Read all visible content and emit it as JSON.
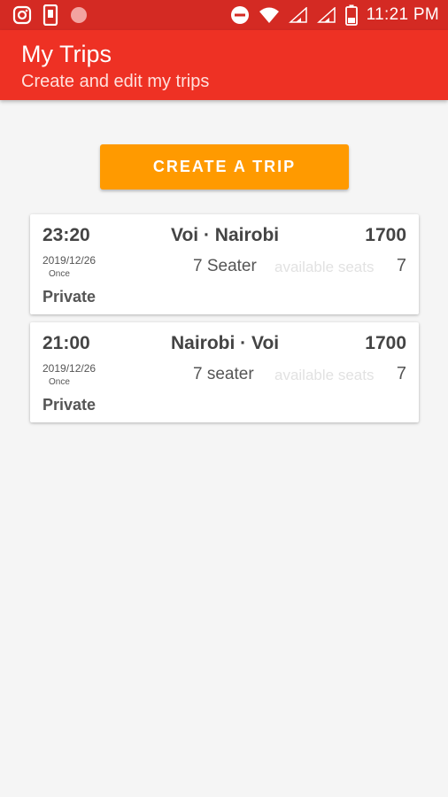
{
  "status_bar": {
    "time": "11:21 PM",
    "icons": [
      "instagram-icon",
      "phone-notification-icon",
      "circle-notification-icon",
      "do-not-disturb-icon",
      "wifi-icon",
      "signal-icon",
      "signal-icon",
      "battery-icon"
    ]
  },
  "app_bar": {
    "title": "My Trips",
    "subtitle": "Create and edit my trips"
  },
  "create_button": {
    "label": "CREATE A TRIP"
  },
  "trips": [
    {
      "time": "23:20",
      "route": "Voi · Nairobi",
      "price": "1700",
      "date": "2019/12/26",
      "frequency": "Once",
      "vehicle": "7 Seater",
      "available_label": "available seats",
      "available_seats": "7",
      "type": "Private"
    },
    {
      "time": "21:00",
      "route": "Nairobi · Voi",
      "price": "1700",
      "date": "2019/12/26",
      "frequency": "Once",
      "vehicle": "7 seater",
      "available_label": "available seats",
      "available_seats": "7",
      "type": "Private"
    }
  ],
  "colors": {
    "status_bar": "#d42a23",
    "app_bar": "#ee3124",
    "accent_button": "#ff9a00",
    "background": "#f5f5f5"
  }
}
